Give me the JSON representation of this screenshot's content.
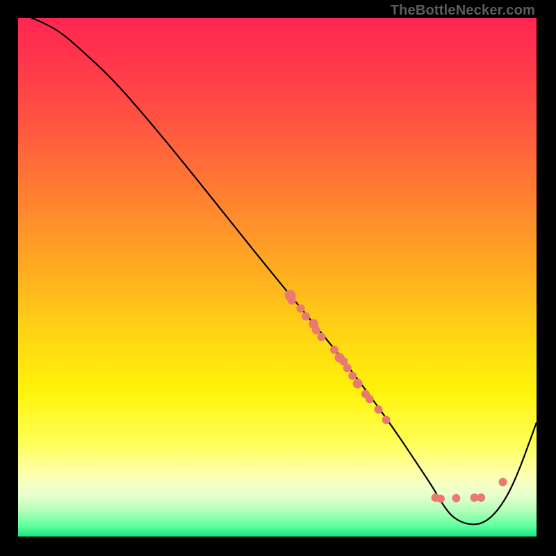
{
  "watermark": "TheBottleNecker.com",
  "chart_data": {
    "type": "line",
    "title": "",
    "xlabel": "",
    "ylabel": "",
    "xlim": [
      0,
      100
    ],
    "ylim": [
      0,
      100
    ],
    "background_gradient": {
      "stops": [
        {
          "offset": 0.0,
          "color": "#ff2652"
        },
        {
          "offset": 0.1,
          "color": "#ff3a4a"
        },
        {
          "offset": 0.22,
          "color": "#ff5a3f"
        },
        {
          "offset": 0.35,
          "color": "#ff8230"
        },
        {
          "offset": 0.48,
          "color": "#ffaa22"
        },
        {
          "offset": 0.6,
          "color": "#ffd214"
        },
        {
          "offset": 0.72,
          "color": "#fff30a"
        },
        {
          "offset": 0.82,
          "color": "#ffff58"
        },
        {
          "offset": 0.88,
          "color": "#ffffb0"
        },
        {
          "offset": 0.92,
          "color": "#e8ffd0"
        },
        {
          "offset": 0.95,
          "color": "#b3ffb8"
        },
        {
          "offset": 0.98,
          "color": "#5dff9f"
        },
        {
          "offset": 1.0,
          "color": "#18e57e"
        }
      ]
    },
    "series": [
      {
        "name": "bottleneck-curve",
        "color": "#000000",
        "stroke_width": 2.2,
        "x": [
          0,
          3,
          8,
          12,
          18,
          25,
          32,
          40,
          48,
          55,
          62,
          68,
          73,
          77,
          80,
          82,
          84,
          87,
          90,
          93,
          96,
          100
        ],
        "y": [
          101,
          100,
          97.5,
          94,
          88.5,
          80.5,
          72,
          62,
          52,
          43.5,
          35,
          27,
          20,
          14,
          9.5,
          6,
          3.5,
          2.2,
          2.6,
          5.5,
          11,
          22
        ]
      }
    ],
    "scatter_points": {
      "name": "data-points",
      "color": "#e97a72",
      "radius": 6,
      "points": [
        {
          "x": 52.5,
          "y": 46.5,
          "r": 8
        },
        {
          "x": 52.8,
          "y": 45.5,
          "r": 6
        },
        {
          "x": 54.5,
          "y": 44.0,
          "r": 6
        },
        {
          "x": 55.5,
          "y": 42.5,
          "r": 6
        },
        {
          "x": 57.0,
          "y": 41.0,
          "r": 7
        },
        {
          "x": 57.5,
          "y": 39.8,
          "r": 6
        },
        {
          "x": 58.5,
          "y": 38.5,
          "r": 6
        },
        {
          "x": 61.0,
          "y": 36.0,
          "r": 6
        },
        {
          "x": 62.0,
          "y": 34.5,
          "r": 7
        },
        {
          "x": 62.8,
          "y": 33.8,
          "r": 6
        },
        {
          "x": 63.5,
          "y": 32.5,
          "r": 6
        },
        {
          "x": 64.5,
          "y": 31.0,
          "r": 6
        },
        {
          "x": 65.5,
          "y": 29.5,
          "r": 7
        },
        {
          "x": 67.0,
          "y": 27.5,
          "r": 6
        },
        {
          "x": 67.8,
          "y": 26.5,
          "r": 6
        },
        {
          "x": 69.5,
          "y": 24.5,
          "r": 6
        },
        {
          "x": 71.0,
          "y": 22.5,
          "r": 6
        },
        {
          "x": 80.5,
          "y": 7.5,
          "r": 6
        },
        {
          "x": 81.5,
          "y": 7.3,
          "r": 6
        },
        {
          "x": 84.5,
          "y": 7.4,
          "r": 6
        },
        {
          "x": 88.0,
          "y": 7.5,
          "r": 6
        },
        {
          "x": 89.3,
          "y": 7.5,
          "r": 6
        },
        {
          "x": 93.5,
          "y": 10.5,
          "r": 6
        }
      ]
    }
  }
}
